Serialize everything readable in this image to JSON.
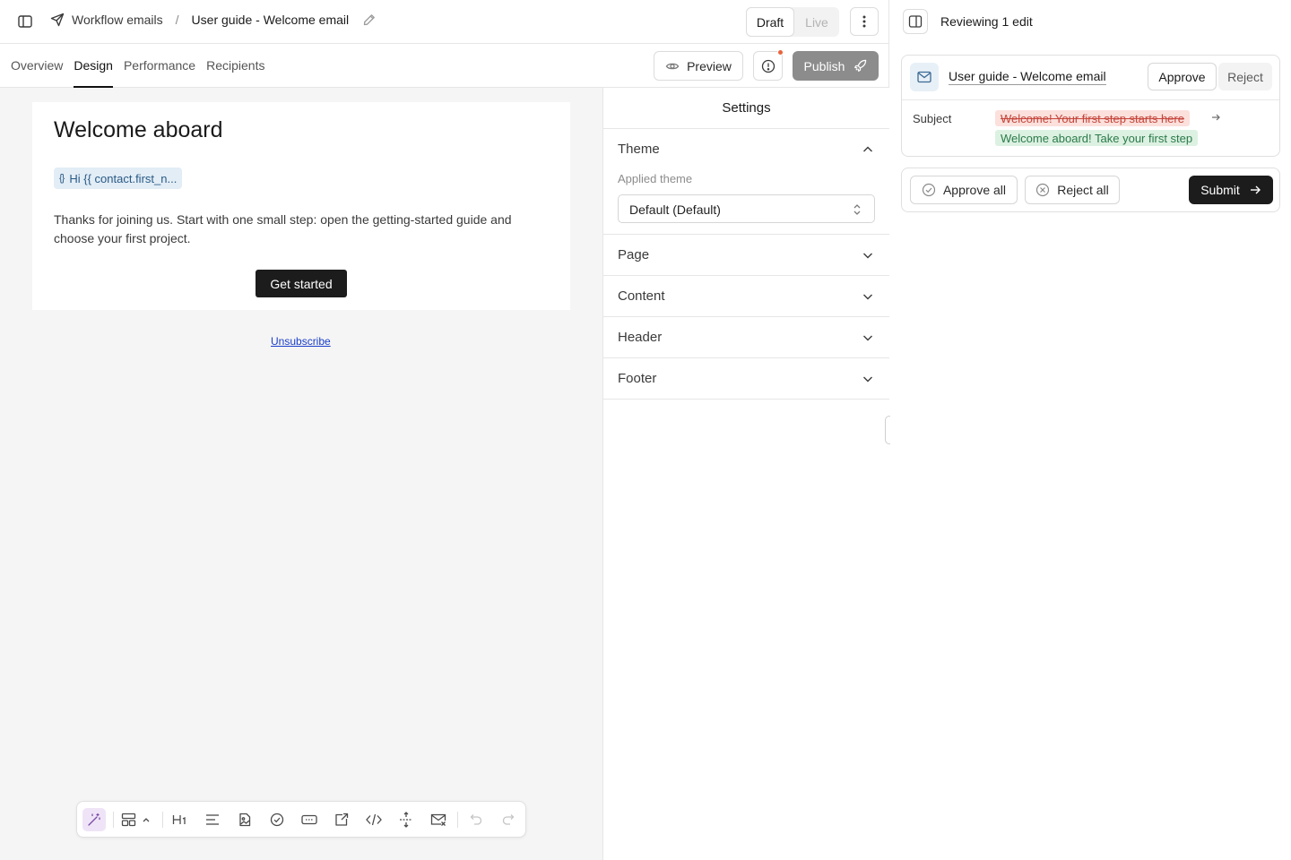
{
  "breadcrumb": {
    "parent": "Workflow emails",
    "separator": "/",
    "current": "User guide - Welcome email"
  },
  "status_toggle": {
    "draft": "Draft",
    "live": "Live",
    "selected": "Draft"
  },
  "tabs": [
    {
      "label": "Overview",
      "active": false
    },
    {
      "label": "Design",
      "active": true
    },
    {
      "label": "Performance",
      "active": false
    },
    {
      "label": "Recipients",
      "active": false
    }
  ],
  "actions": {
    "preview": "Preview",
    "publish": "Publish"
  },
  "email": {
    "title": "Welcome aboard",
    "variable_chip": "Hi {{ contact.first_n...",
    "variable_icon": "{}",
    "body": "Thanks for joining us. Start with one small step: open the getting-started guide and choose your first project.",
    "cta": "Get started",
    "unsubscribe": "Unsubscribe"
  },
  "settings": {
    "title": "Settings",
    "theme": {
      "label": "Theme",
      "sub_label": "Applied theme",
      "value": "Default (Default)",
      "expanded": true
    },
    "sections": [
      {
        "label": "Page"
      },
      {
        "label": "Content"
      },
      {
        "label": "Header"
      },
      {
        "label": "Footer"
      }
    ]
  },
  "review": {
    "title": "Reviewing 1 edit",
    "edit": {
      "name": "User guide - Welcome email",
      "approve": "Approve",
      "reject": "Reject",
      "field_label": "Subject",
      "old_value": "Welcome! Your first step starts here",
      "new_value": "Welcome aboard! Take your first step"
    },
    "approve_all": "Approve all",
    "reject_all": "Reject all",
    "submit": "Submit"
  },
  "colors": {
    "publish_disabled": "#8c8c8c",
    "alert_dot": "#e8643a",
    "diff_removed_bg": "#fbe0dc",
    "diff_added_bg": "#dcf1e2",
    "primary_dark": "#1c1c1c"
  }
}
